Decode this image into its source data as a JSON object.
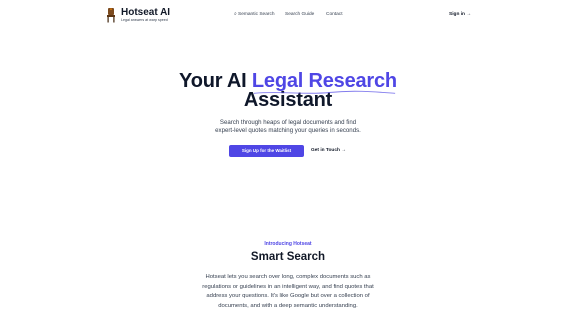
{
  "brand": {
    "name": "Hotseat AI",
    "tagline": "Legal answers at warp speed"
  },
  "nav": {
    "links": [
      "⌕ Semantic Search",
      "Search Guide",
      "Contact"
    ],
    "sign_in": "Sign in →"
  },
  "hero": {
    "title_prefix": "Your AI ",
    "title_accent": "Legal Research",
    "title_suffix": "Assistant",
    "subtitle": "Search through heaps of legal documents and find expert-level quotes matching your queries in seconds.",
    "primary_cta": "Sign Up for the Waitlist",
    "secondary_cta": "Get in Touch →",
    "accent_color": "#4f46e5"
  },
  "features": {
    "eyebrow": "Introducing Hotseat",
    "title": "Smart Search",
    "body": "Hotseat lets you search over long, complex documents such as regulations or guidelines in an intelligent way, and find quotes that address your questions. It's like Google but over a collection of documents, and with a deep semantic understanding."
  }
}
